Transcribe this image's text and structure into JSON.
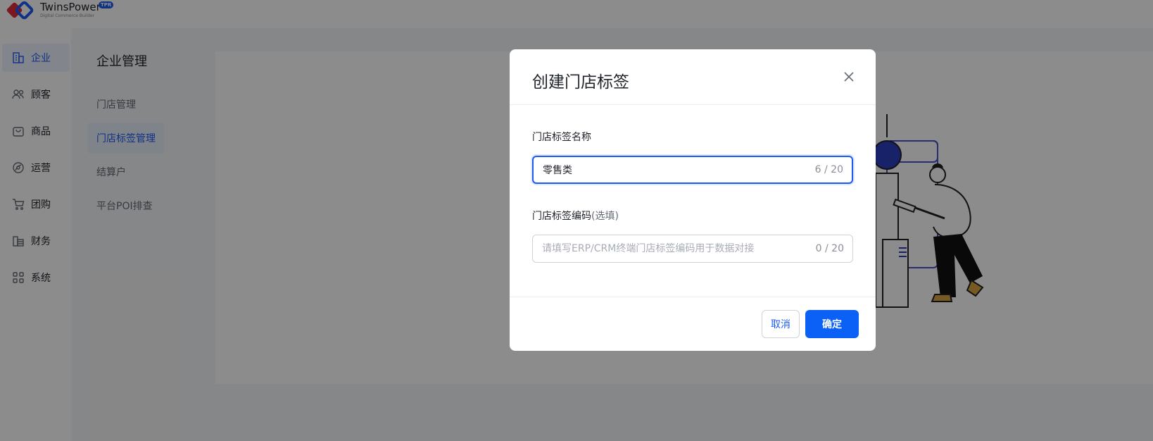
{
  "brand": {
    "name": "TwinsPower",
    "tag": "TPR",
    "subtitle": "Digital Commerce Builder"
  },
  "sidenav": {
    "items": [
      {
        "label": "企业",
        "icon": "building-icon",
        "active": true
      },
      {
        "label": "顾客",
        "icon": "users-icon",
        "active": false
      },
      {
        "label": "商品",
        "icon": "bag-icon",
        "active": false
      },
      {
        "label": "运营",
        "icon": "compass-icon",
        "active": false
      },
      {
        "label": "团购",
        "icon": "cart-icon",
        "active": false
      },
      {
        "label": "财务",
        "icon": "coins-icon",
        "active": false
      },
      {
        "label": "系统",
        "icon": "grid-icon",
        "active": false
      }
    ]
  },
  "subnav": {
    "title": "企业管理",
    "items": [
      {
        "label": "门店管理",
        "active": false
      },
      {
        "label": "门店标签管理",
        "active": true
      },
      {
        "label": "结算户",
        "active": false
      },
      {
        "label": "平台POI排查",
        "active": false
      }
    ]
  },
  "modal": {
    "title": "创建门店标签",
    "name_field": {
      "label": "门店标签名称",
      "value": "零售类",
      "counter": "6 / 20"
    },
    "code_field": {
      "label": "门店标签编码",
      "optional": "(选填)",
      "value": "",
      "placeholder": "请填写ERP/CRM终端门店标签编码用于数据对接",
      "counter": "0 / 20"
    },
    "cancel_label": "取消",
    "confirm_label": "确定"
  },
  "colors": {
    "accent": "#1d5bf0",
    "primary_button": "#0b61f5",
    "overlay": "rgba(0,0,0,0.45)"
  }
}
